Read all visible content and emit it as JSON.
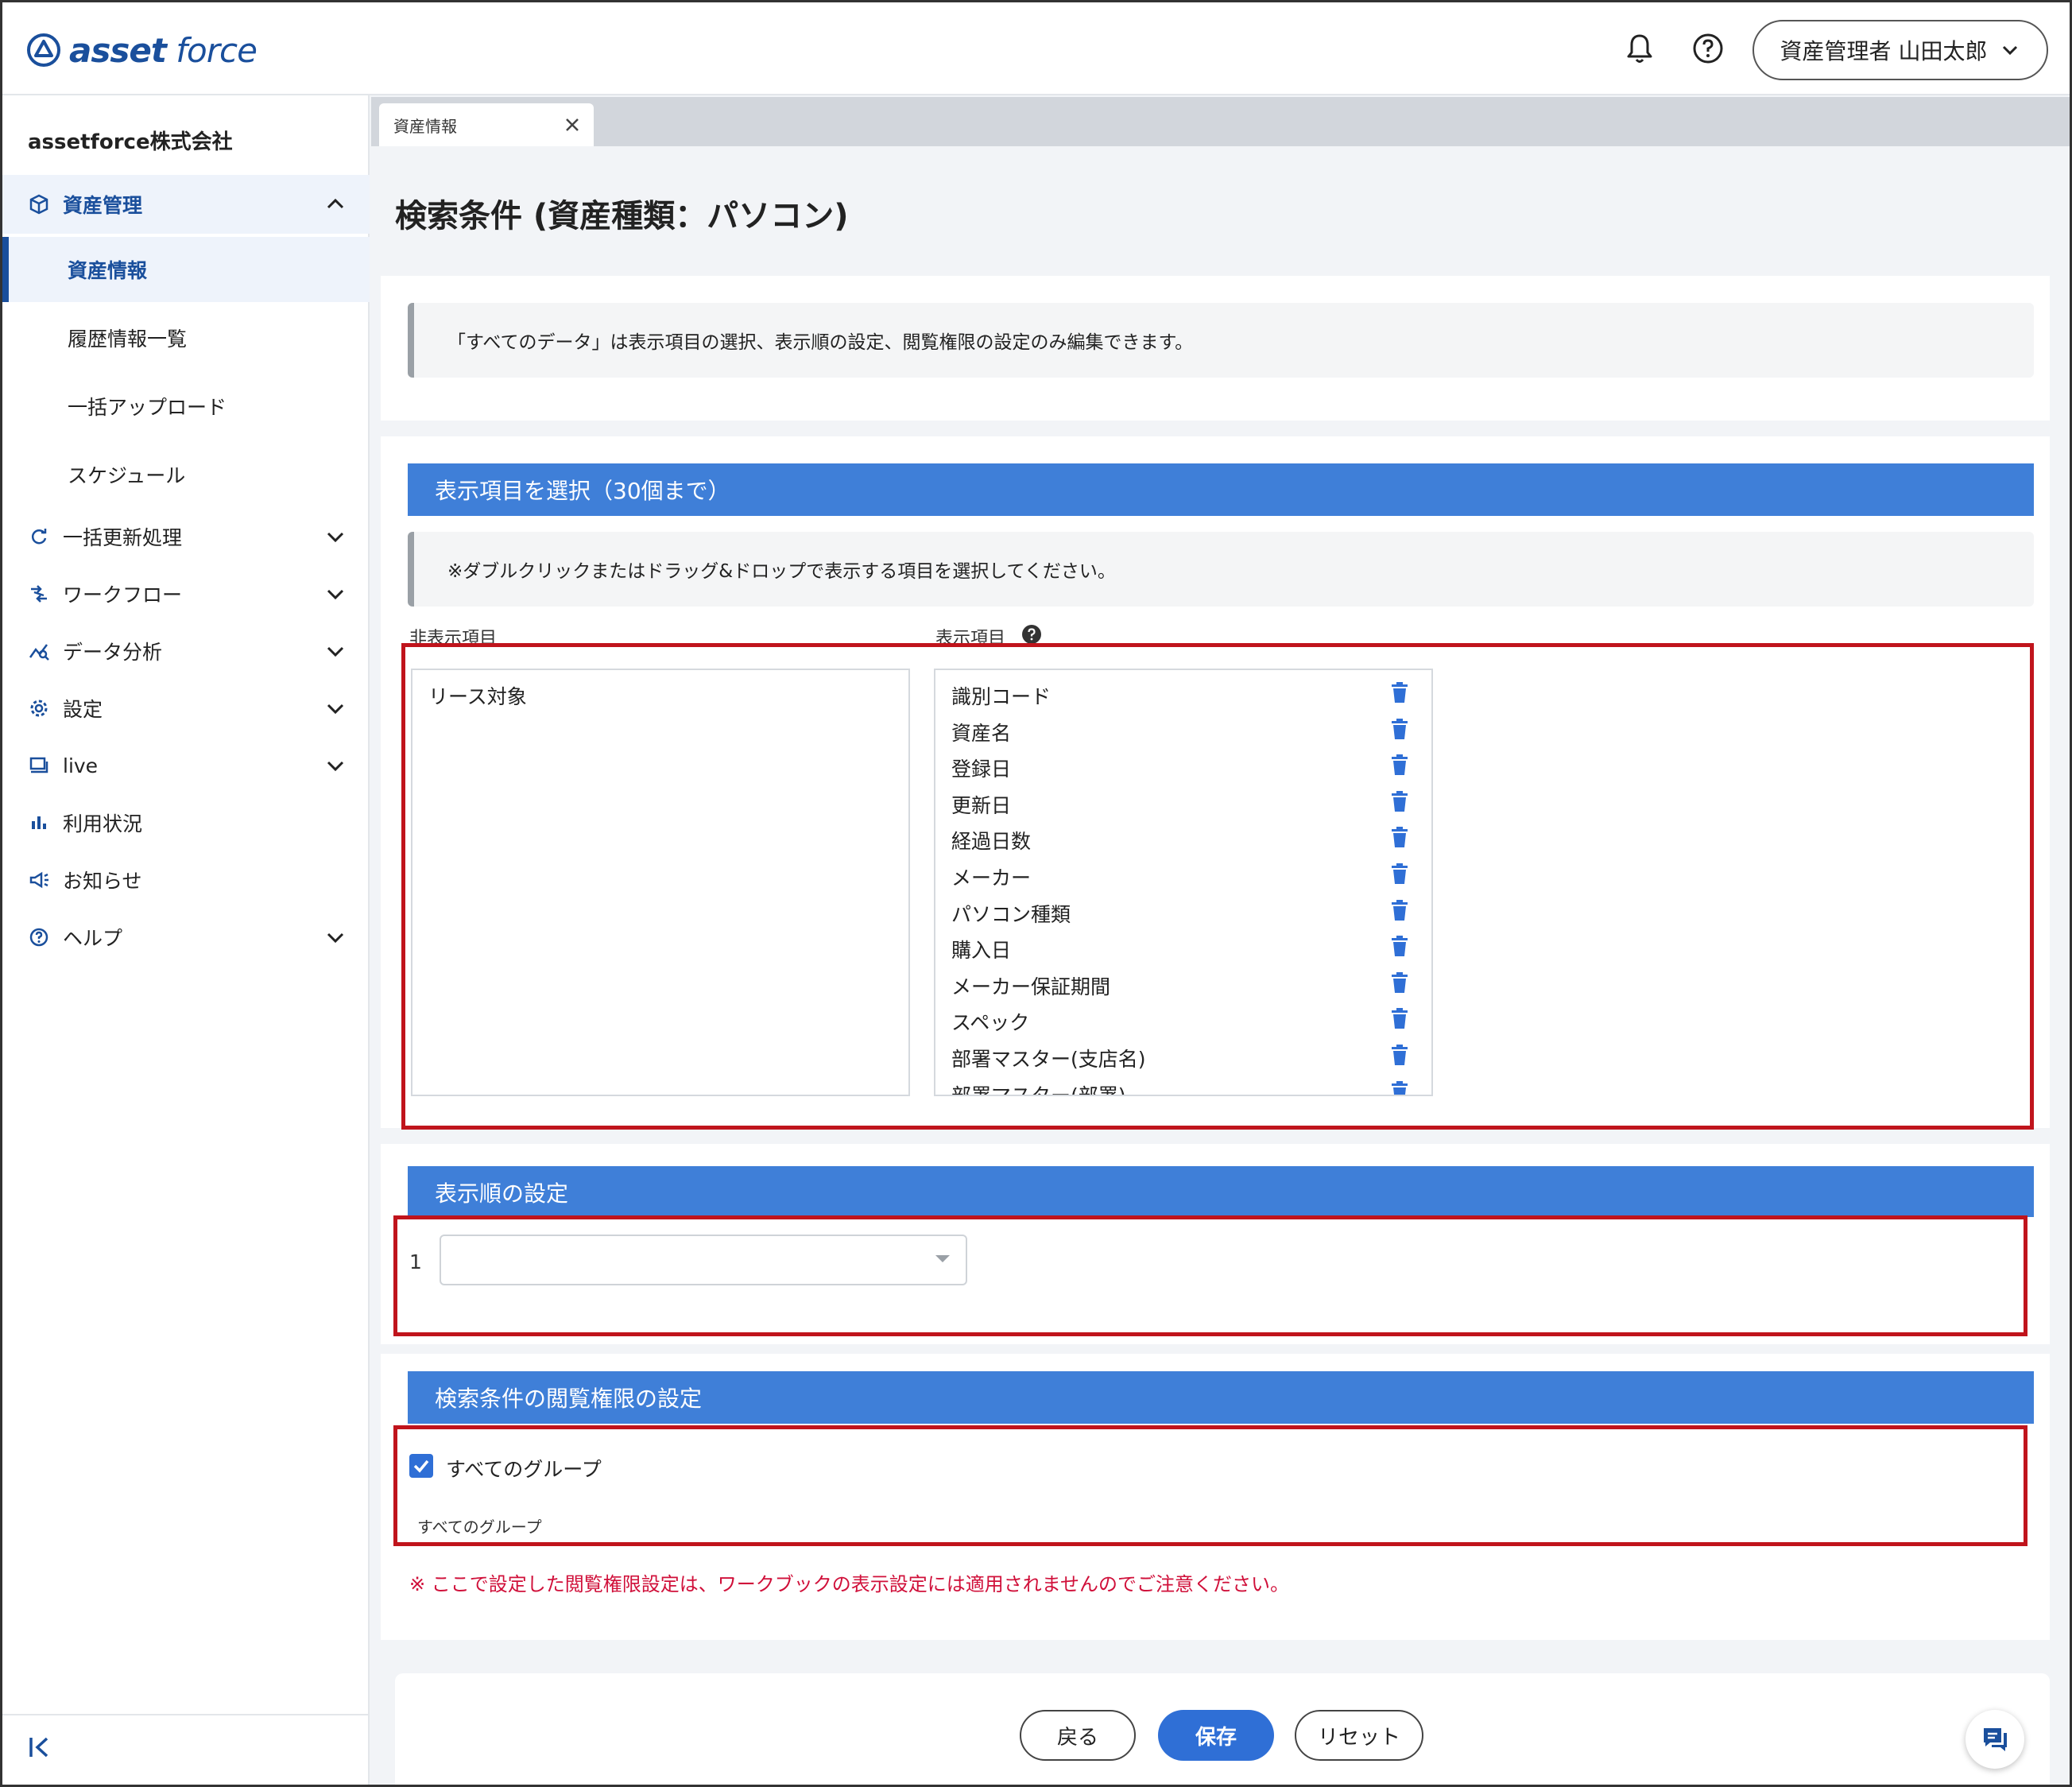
{
  "header": {
    "logo_bold": "asset",
    "logo_light": "force",
    "user_label": "資産管理者 山田太郎",
    "icons": [
      "bell-icon",
      "help-circle-icon",
      "chevron-down-icon"
    ]
  },
  "sidebar": {
    "company": "assetforce株式会社",
    "groups": [
      {
        "label": "資産管理",
        "icon": "cube-icon",
        "expanded": true,
        "items": [
          "資産情報",
          "履歴情報一覧",
          "一括アップロード",
          "スケジュール"
        ],
        "selected": "資産情報"
      },
      {
        "label": "一括更新処理",
        "icon": "refresh-icon"
      },
      {
        "label": "ワークフロー",
        "icon": "workflow-icon"
      },
      {
        "label": "データ分析",
        "icon": "analytics-icon"
      },
      {
        "label": "設定",
        "icon": "gear-icon"
      },
      {
        "label": "live",
        "icon": "live-icon"
      },
      {
        "label": "利用状況",
        "icon": "bar-chart-icon"
      },
      {
        "label": "お知らせ",
        "icon": "megaphone-icon"
      },
      {
        "label": "ヘルプ",
        "icon": "help-icon"
      }
    ]
  },
  "tabs": [
    {
      "label": "資産情報"
    }
  ],
  "page": {
    "title": "検索条件 (資産種類：パソコン)",
    "notice": "「すべてのデータ」は表示項目の選択、表示順の設定、閲覧権限の設定のみ編集できます。"
  },
  "display_items": {
    "heading": "表示項目を選択（30個まで）",
    "hint": "※ダブルクリックまたはドラッグ&ドロップで表示する項目を選択してください。",
    "hidden_label": "非表示項目",
    "shown_label": "表示項目",
    "hidden": [
      "リース対象"
    ],
    "shown": [
      "識別コード",
      "資産名",
      "登録日",
      "更新日",
      "経過日数",
      "メーカー",
      "パソコン種類",
      "購入日",
      "メーカー保証期間",
      "スペック",
      "部署マスター(支店名)",
      "部署マスター(部署)"
    ]
  },
  "sort_order": {
    "heading": "表示順の設定",
    "row_number": "1",
    "selected_value": ""
  },
  "permissions": {
    "heading": "検索条件の閲覧権限の設定",
    "checkbox_label": "すべてのグループ",
    "checked": true,
    "selected_groups": "すべてのグループ",
    "warning": "※ ここで設定した閲覧権限設定は、ワークブックの表示設定には適用されませんのでご注意ください。"
  },
  "footer": {
    "back": "戻る",
    "save": "保存",
    "reset": "リセット"
  },
  "colors": {
    "brand": "#1a4f9c",
    "section_header": "#3f7fd8",
    "primary_button": "#2f6fd6",
    "highlight_box": "#c0141c",
    "warning_text": "#d0103a"
  }
}
